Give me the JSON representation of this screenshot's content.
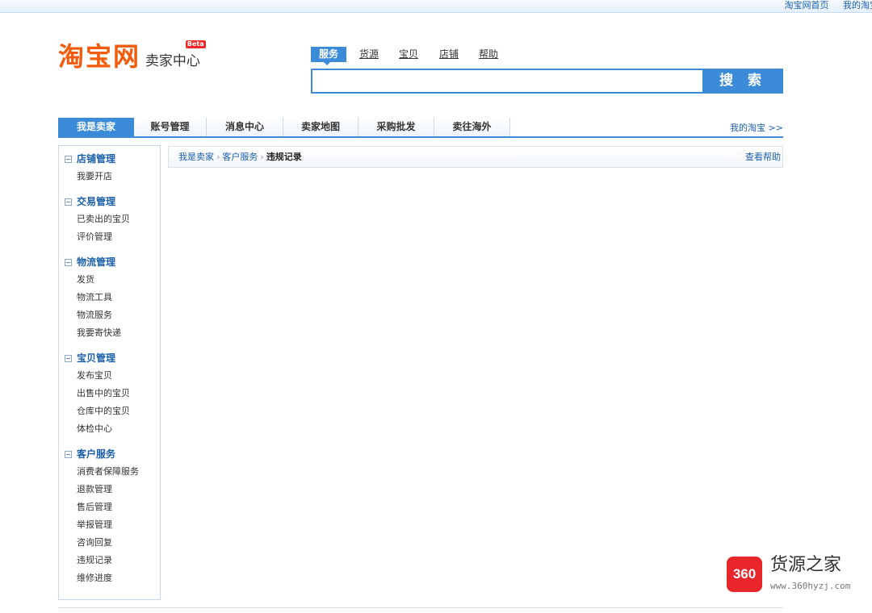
{
  "topbar": {
    "links": [
      "淘宝网首页",
      "我的淘宝"
    ]
  },
  "logo": {
    "main": "淘宝网",
    "sub": "卖家中心",
    "badge": "Beta"
  },
  "search": {
    "tabs": [
      "服务",
      "货源",
      "宝贝",
      "店铺",
      "帮助"
    ],
    "active_tab": "服务",
    "value": "",
    "button": "搜 索"
  },
  "mainnav": {
    "items": [
      "我是卖家",
      "账号管理",
      "消息中心",
      "卖家地图",
      "采购批发",
      "卖往海外"
    ],
    "active": "我是卖家",
    "right_link": "我的淘宝 >>"
  },
  "sidebar": {
    "groups": [
      {
        "title": "店铺管理",
        "items": [
          "我要开店"
        ]
      },
      {
        "title": "交易管理",
        "items": [
          "已卖出的宝贝",
          "评价管理"
        ]
      },
      {
        "title": "物流管理",
        "items": [
          "发货",
          "物流工具",
          "物流服务",
          "我要寄快递"
        ]
      },
      {
        "title": "宝贝管理",
        "items": [
          "发布宝贝",
          "出售中的宝贝",
          "仓库中的宝贝",
          "体检中心"
        ]
      },
      {
        "title": "客户服务",
        "items": [
          "消费者保障服务",
          "退款管理",
          "售后管理",
          "举报管理",
          "咨询回复",
          "违规记录",
          "维修进度"
        ]
      }
    ]
  },
  "breadcrumb": {
    "items": [
      "我是卖家",
      "客户服务"
    ],
    "current": "违规记录",
    "help": "查看帮助"
  },
  "watermark": {
    "badge": "360",
    "title": "货源之家",
    "url": "www.360hyzj.com"
  }
}
